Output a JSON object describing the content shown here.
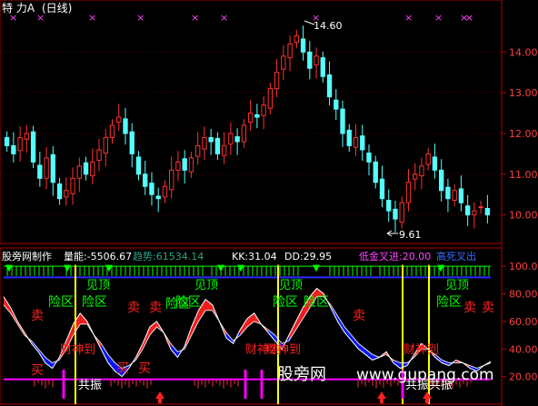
{
  "title": {
    "symbol": "特  力A",
    "period": "(日线)"
  },
  "top_axis": {
    "ticks": [
      "14.00",
      "13.00",
      "12.00",
      "11.00",
      "10.00"
    ]
  },
  "price_marks": {
    "high_label": "14.60",
    "low_label": "9.61"
  },
  "indicator_header": [
    {
      "text": "股旁网制作",
      "color": "#ffffff"
    },
    {
      "text": "量能:-5506.67",
      "color": "#ffffff"
    },
    {
      "text": "趋势:61534.14",
      "color": "#2aa58a"
    },
    {
      "text": "KK:31.04",
      "color": "#ffffff"
    },
    {
      "text": "DD:29.95",
      "color": "#ffffff"
    },
    {
      "text": "低金叉进:20.00",
      "color": "#ff44ff"
    },
    {
      "text": "高死叉出",
      "color": "#3a6cff"
    }
  ],
  "bottom_axis": {
    "ticks": [
      "100.00",
      "80.00",
      "60.00",
      "40.00",
      "20.00"
    ]
  },
  "annotations": {
    "risk_zone": "险区",
    "top_watch": "见顶",
    "sell": "卖",
    "buy": "买",
    "wealth": "财神到",
    "resonance": "共振"
  },
  "watermark": {
    "cn": "股旁网",
    "url": "www.gupang.com"
  },
  "colors": {
    "up": "#ff3030",
    "down": "#55ffff",
    "indicator_fill_down": "#0a18ff",
    "indicator_fill_up": "#ff2020",
    "guide_blue": "#2a2aff",
    "guide_magenta": "#ff00ff",
    "yellow": "#ffff00",
    "green": "#00ff00"
  },
  "chart_data": [
    {
      "type": "candlestick",
      "title": "",
      "ylim": [
        9.3,
        15.1
      ],
      "y_ticks": [
        10,
        11,
        12,
        13,
        14
      ],
      "high": 14.6,
      "low": 9.61,
      "close_series": [
        11.7,
        11.5,
        11.9,
        12.0,
        11.3,
        10.9,
        11.4,
        10.8,
        10.4,
        10.6,
        10.9,
        11.2,
        11.0,
        11.3,
        11.6,
        11.9,
        12.2,
        12.4,
        12.0,
        11.5,
        11.0,
        10.7,
        10.5,
        10.4,
        10.7,
        11.1,
        11.3,
        11.1,
        11.4,
        11.7,
        11.9,
        11.8,
        11.5,
        11.7,
        12.0,
        11.8,
        12.2,
        12.5,
        12.4,
        12.7,
        13.1,
        13.5,
        13.9,
        14.2,
        14.4,
        14.0,
        13.6,
        13.9,
        13.4,
        12.9,
        12.6,
        12.0,
        11.7,
        11.9,
        11.6,
        11.3,
        10.8,
        10.4,
        10.1,
        9.9,
        10.3,
        10.8,
        11.0,
        11.2,
        11.5,
        11.1,
        10.6,
        10.4,
        10.6,
        10.3,
        10.0,
        10.1,
        10.2,
        10.0
      ]
    },
    {
      "type": "line",
      "title": "",
      "ylim": [
        0,
        110
      ],
      "y_ticks": [
        20,
        40,
        60,
        80,
        100
      ],
      "series": [
        {
          "name": "KK",
          "values": [
            78,
            70,
            60,
            52,
            44,
            38,
            30,
            26,
            34,
            46,
            58,
            66,
            60,
            50,
            40,
            30,
            24,
            20,
            26,
            34,
            44,
            56,
            60,
            52,
            40,
            34,
            42,
            56,
            68,
            76,
            72,
            60,
            48,
            44,
            54,
            62,
            66,
            58,
            52,
            46,
            40,
            50,
            60,
            70,
            78,
            84,
            80,
            70,
            60,
            52,
            46,
            40,
            36,
            32,
            34,
            38,
            30,
            26,
            28,
            36,
            44,
            40,
            34,
            30,
            28,
            32,
            30,
            26,
            24,
            28,
            31
          ]
        },
        {
          "name": "DD",
          "values": [
            72,
            66,
            58,
            50,
            46,
            40,
            34,
            30,
            32,
            40,
            50,
            58,
            58,
            50,
            44,
            36,
            30,
            26,
            28,
            32,
            40,
            50,
            56,
            52,
            44,
            38,
            40,
            50,
            60,
            68,
            68,
            60,
            52,
            46,
            50,
            56,
            60,
            58,
            54,
            50,
            44,
            46,
            54,
            62,
            70,
            78,
            78,
            72,
            64,
            56,
            50,
            44,
            40,
            36,
            34,
            36,
            32,
            30,
            30,
            34,
            40,
            40,
            36,
            32,
            30,
            30,
            30,
            28,
            26,
            28,
            30
          ]
        }
      ]
    }
  ]
}
